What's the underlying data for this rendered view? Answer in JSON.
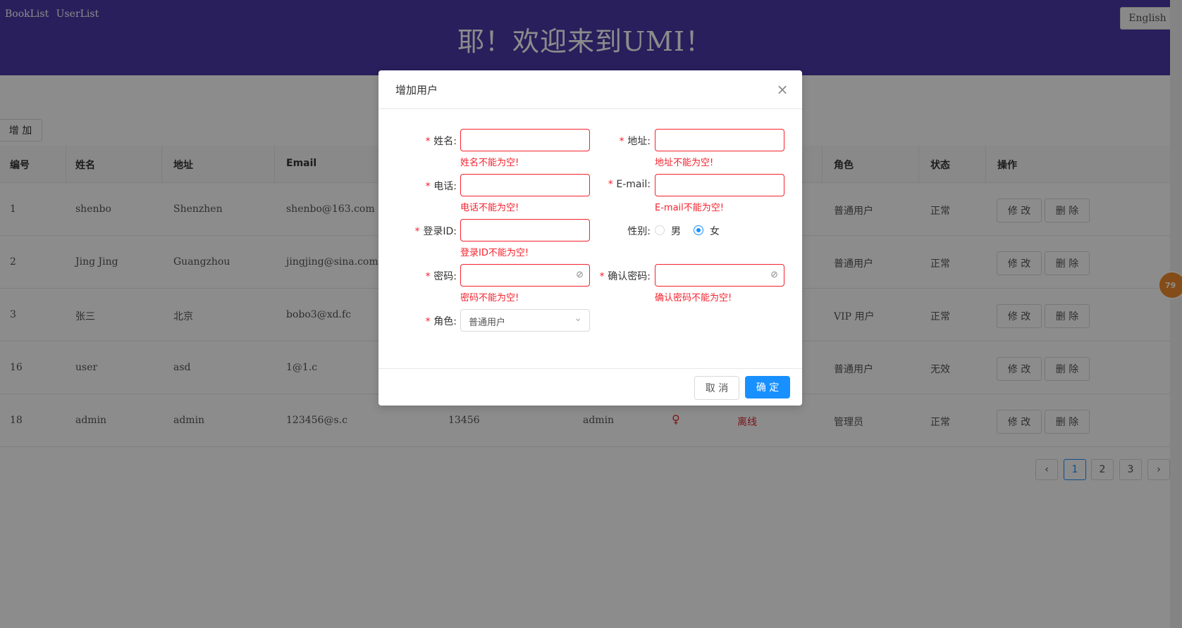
{
  "header": {
    "nav": [
      "BookList",
      "UserList"
    ],
    "welcome": "耶！欢迎来到UMI！",
    "lang_button": "English"
  },
  "page": {
    "add_button": "增 加",
    "table": {
      "columns": [
        "编号",
        "姓名",
        "地址",
        "Email",
        "",
        "",
        "",
        "",
        "角色",
        "状态",
        "操作"
      ],
      "rows": [
        {
          "id": "1",
          "name": "shenbo",
          "address": "Shenzhen",
          "email": "shenbo@163.com",
          "phone": "",
          "login": "",
          "gender": "",
          "online": "",
          "role": "普通用户",
          "status": "正常"
        },
        {
          "id": "2",
          "name": "Jing Jing",
          "address": "Guangzhou",
          "email": "jingjing@sina.com",
          "phone": "",
          "login": "",
          "gender": "",
          "online": "",
          "role": "普通用户",
          "status": "正常"
        },
        {
          "id": "3",
          "name": "张三",
          "address": "北京",
          "email": "bobo3@xd.fc",
          "phone": "",
          "login": "",
          "gender": "",
          "online": "",
          "role": "VIP 用户",
          "status": "正常"
        },
        {
          "id": "16",
          "name": "user",
          "address": "asd",
          "email": "1@1.c",
          "phone": "",
          "login": "",
          "gender": "",
          "online": "",
          "role": "普通用户",
          "status": "无效"
        },
        {
          "id": "18",
          "name": "admin",
          "address": "admin",
          "email": "123456@s.c",
          "phone": "13456",
          "login": "admin",
          "gender": "♀",
          "online": "离线",
          "role": "管理员",
          "status": "正常"
        }
      ],
      "edit_label": "修 改",
      "delete_label": "删 除"
    },
    "pagination": {
      "prev": "‹",
      "pages": [
        "1",
        "2",
        "3"
      ],
      "next": "›",
      "current": "1"
    },
    "float_badge": "79"
  },
  "modal": {
    "title": "增加用户",
    "close": "×",
    "fields": {
      "name": {
        "label": "姓名",
        "error": "姓名不能为空!"
      },
      "address": {
        "label": "地址",
        "error": "地址不能为空!"
      },
      "phone": {
        "label": "电话",
        "error": "电话不能为空!"
      },
      "email": {
        "label": "E-mail",
        "error": "E-mail不能为空!"
      },
      "login_id": {
        "label": "登录ID",
        "error": "登录ID不能为空!"
      },
      "gender": {
        "label": "性别",
        "options": [
          "男",
          "女"
        ],
        "selected": "女"
      },
      "password": {
        "label": "密码",
        "error": "密码不能为空!"
      },
      "confirm_password": {
        "label": "确认密码",
        "error": "确认密码不能为空!"
      },
      "role": {
        "label": "角色",
        "value": "普通用户"
      }
    },
    "colon": ":",
    "required_mark": "*",
    "cancel": "取 消",
    "ok": "确 定"
  },
  "colors": {
    "header_bg": "#4a3aa8",
    "primary": "#1890ff",
    "error": "#f5222d"
  }
}
